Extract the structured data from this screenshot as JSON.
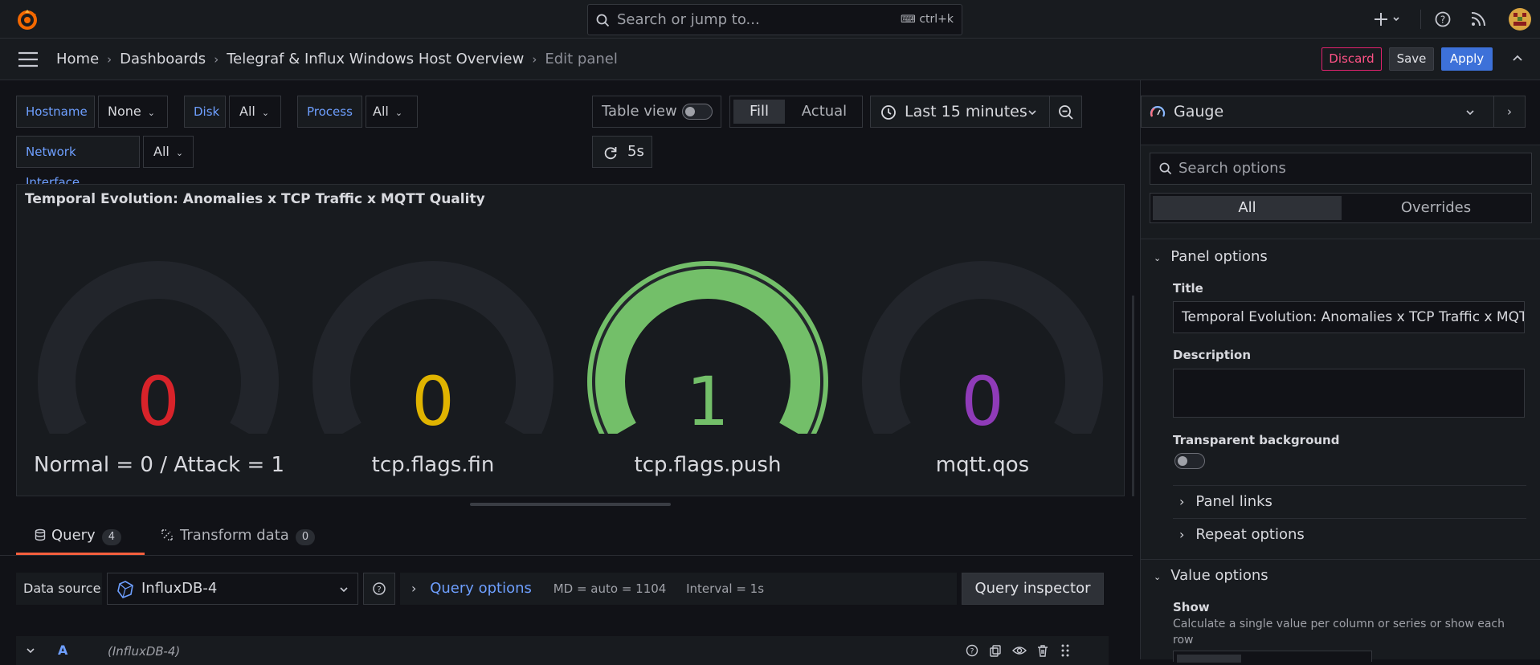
{
  "topbar": {
    "search_placeholder": "Search or jump to...",
    "search_shortcut": "ctrl+k",
    "icons": [
      "grafana-logo-icon",
      "plus-icon",
      "help-icon",
      "news-rss-icon",
      "user-avatar"
    ]
  },
  "breadcrumbs": [
    "Home",
    "Dashboards",
    "Telegraf & Influx Windows Host Overview",
    "Edit panel"
  ],
  "actions": {
    "discard": "Discard",
    "save": "Save",
    "apply": "Apply"
  },
  "variables": [
    {
      "label": "Hostname",
      "value": "None"
    },
    {
      "label": "Disk",
      "value": "All"
    },
    {
      "label": "Process",
      "value": "All"
    },
    {
      "label": "Network Interface",
      "value": "All"
    }
  ],
  "view_controls": {
    "table_view": "Table view",
    "table_view_on": false,
    "fill": "Fill",
    "actual": "Actual",
    "time_range": "Last 15 minutes",
    "refresh": "5s"
  },
  "panel": {
    "title": "Temporal Evolution: Anomalies x TCP Traffic x MQTT Quality",
    "gauges": [
      {
        "value": "0",
        "label": "Normal = 0 / Attack = 1",
        "color": "#d8232a",
        "fill": 0
      },
      {
        "value": "0",
        "label": "tcp.flags.fin",
        "color": "#e0b400",
        "fill": 0
      },
      {
        "value": "1",
        "label": "tcp.flags.push",
        "color": "#73bf69",
        "fill": 1
      },
      {
        "value": "0",
        "label": "mqtt.qos",
        "color": "#8f3bb8",
        "fill": 0
      }
    ]
  },
  "query_tabs": [
    {
      "label": "Query",
      "count": "4",
      "active": true
    },
    {
      "label": "Transform data",
      "count": "0",
      "active": false
    }
  ],
  "datasource": {
    "label": "Data source",
    "value": "InfluxDB-4",
    "query_options": "Query options",
    "md": "MD = auto = 1104",
    "interval": "Interval = 1s",
    "inspector": "Query inspector"
  },
  "query_row": {
    "ref": "A",
    "source": "(InfluxDB-4)"
  },
  "options": {
    "viz": "Gauge",
    "search_placeholder": "Search options",
    "tabs": [
      "All",
      "Overrides"
    ],
    "panel_options": "Panel options",
    "title_label": "Title",
    "title_value": "Temporal Evolution: Anomalies x TCP Traffic x MQTT Quality",
    "description_label": "Description",
    "transparent_label": "Transparent background",
    "panel_links": "Panel links",
    "repeat_options": "Repeat options",
    "value_options": "Value options",
    "show_label": "Show",
    "show_desc": "Calculate a single value per column or series or show each row"
  },
  "colors": {
    "accent": "#3d71d9",
    "link": "#6e9fff",
    "danger": "#ff5286",
    "tab_underline": "#f55f3e"
  }
}
